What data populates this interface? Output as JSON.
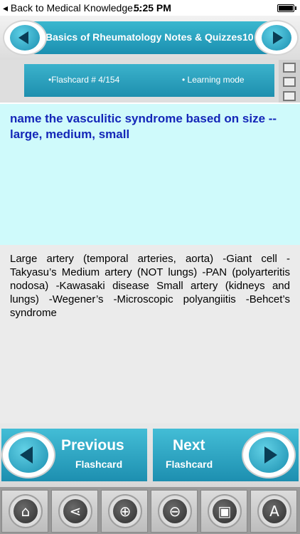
{
  "status_bar": {
    "back_label": "◂ Back to Medical Knowledge...",
    "time": "5:25 PM"
  },
  "header": {
    "title": "Basics of Rheumatology Notes & Quizzes10",
    "prev_icon": "left-arrow-icon",
    "next_icon": "right-arrow-icon"
  },
  "flashcard_info": {
    "counter": "•Flashcard #  4/154",
    "mode": "• Learning mode"
  },
  "question": {
    "text": "name the vasculitic syndrome based on size -- large, medium, small"
  },
  "answer": {
    "text": "Large artery (temporal arteries, aorta) -Giant cell -Takyasu’s  Medium artery (NOT lungs) -PAN (polyarteritis nodosa) -Kawasaki disease  Small artery (kidneys and lungs) -Wegener’s -Microscopic polyangiitis -Behcet’s syndrome"
  },
  "nav": {
    "previous": {
      "line1": "Previous",
      "line2": "Flashcard"
    },
    "next": {
      "line1": "Next",
      "line2": "Flashcard"
    }
  },
  "toolbar": {
    "items": [
      "home-icon",
      "share-icon",
      "zoom-in-icon",
      "zoom-out-icon",
      "image-icon",
      "font-icon"
    ]
  },
  "colors": {
    "accent": "#1d8fb0",
    "question_bg": "#cffafb",
    "question_text": "#1426b8"
  }
}
